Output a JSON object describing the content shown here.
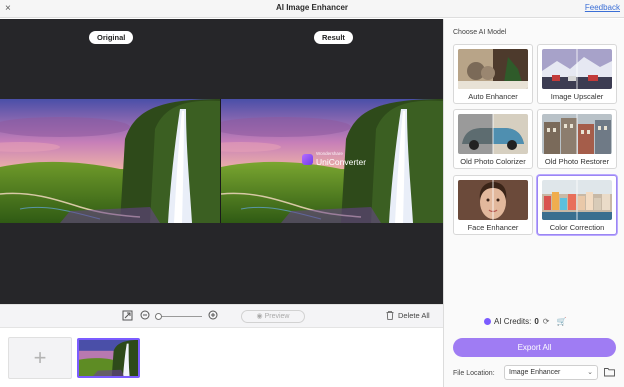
{
  "window": {
    "title": "AI Image Enhancer",
    "close_glyph": "×",
    "feedback_label": "Feedback"
  },
  "preview": {
    "original_label": "Original",
    "result_label": "Result",
    "watermark_sub": "Wondershare",
    "watermark_name": "UniConverter"
  },
  "toolbar": {
    "preview_label": "Preview",
    "delete_all_label": "Delete All",
    "zoom_level": 0
  },
  "strip": {
    "add_glyph": "+"
  },
  "panel": {
    "title": "Choose AI Model",
    "models": [
      {
        "label": "Auto Enhancer",
        "selected": false
      },
      {
        "label": "Image Upscaler",
        "selected": false
      },
      {
        "label": "Old Photo Colorizer",
        "selected": false
      },
      {
        "label": "Old Photo Restorer",
        "selected": false
      },
      {
        "label": "Face Enhancer",
        "selected": false
      },
      {
        "label": "Color Correction",
        "selected": true
      }
    ],
    "credits_label": "AI Credits:",
    "credits_count": "0",
    "export_label": "Export All",
    "file_location_label": "File Location:",
    "file_location_value": "Image Enhancer"
  },
  "colors": {
    "accent": "#9f7cf3",
    "preview_bg": "#262629",
    "selected_border": "#9b86f2"
  }
}
